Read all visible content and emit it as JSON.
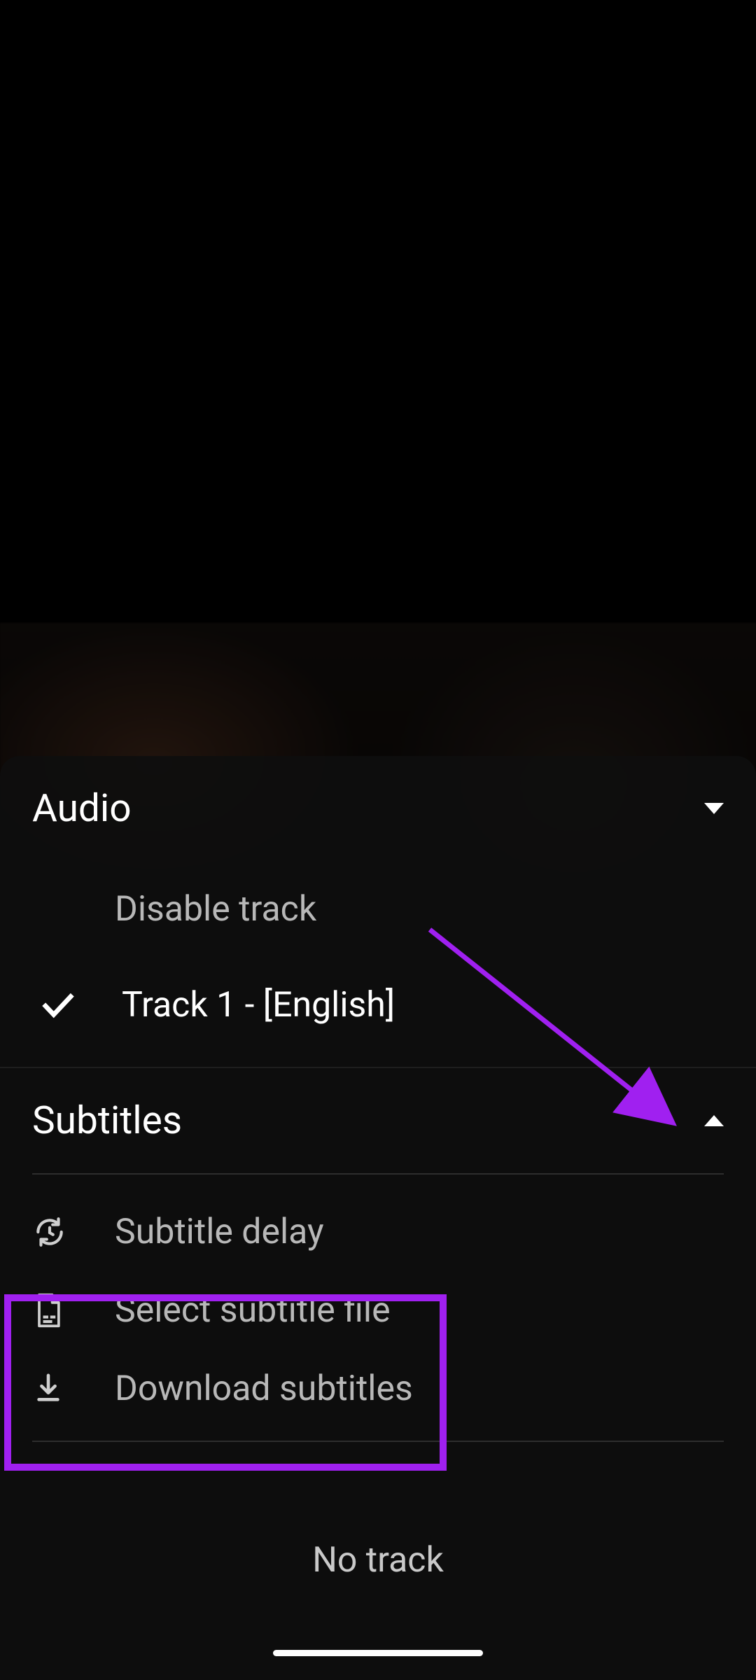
{
  "colors": {
    "accent_annotation": "#a020f0",
    "text_primary": "#ffffff",
    "text_muted": "#b8b8b8"
  },
  "audio": {
    "title": "Audio",
    "expanded": false,
    "items": [
      {
        "label": "Disable track",
        "selected": false
      },
      {
        "label": "Track 1 - [English]",
        "selected": true
      }
    ]
  },
  "subtitles": {
    "title": "Subtitles",
    "expanded": true,
    "actions": [
      {
        "icon": "sync-icon",
        "label": "Subtitle delay"
      },
      {
        "icon": "file-icon",
        "label": "Select subtitle file"
      },
      {
        "icon": "download-icon",
        "label": "Download subtitles"
      }
    ],
    "no_track_label": "No track"
  }
}
